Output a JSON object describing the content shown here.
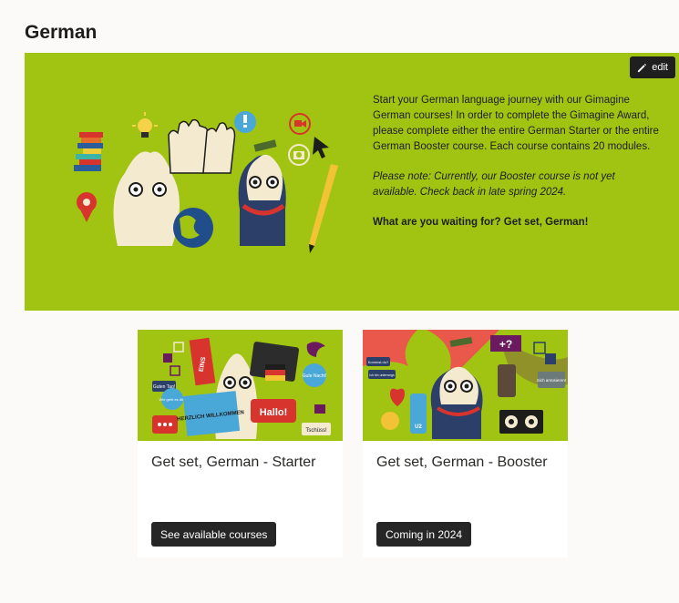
{
  "page": {
    "title": "German"
  },
  "hero": {
    "edit_label": "edit",
    "paragraph1": "Start your German language journey with our Gimagine German courses! In order to complete the Gimagine Award, please complete either the entire German Starter or the entire German Booster course. Each course contains 20 modules.",
    "note": "Please note: Currently, our Booster course is not yet available. Check back in late spring 2024.",
    "cta": "What are you waiting for? Get set, German!"
  },
  "cards": [
    {
      "title": "Get set, German - Starter",
      "button_label": "See available courses",
      "image_texts": {
        "eins": "EINS",
        "guten_tag": "Guten Tag!",
        "wie_gehts": "Wie geht es dir?",
        "herzlich": "HERZLICH WILLKOMMEN",
        "hallo": "Hallo!",
        "gute_nacht": "Gute Nacht!",
        "tschuess": "Tschüss!"
      }
    },
    {
      "title": "Get set, German - Booster",
      "button_label": "Coming in 2024",
      "image_texts": {
        "kommst": "Kommst du?",
        "bin_unterwegs": "Ich bin unterwegs",
        "sich_amuesieren": "Sich amüsieren!",
        "u2": "U2"
      }
    }
  ],
  "colors": {
    "hero_bg": "#a1c412",
    "button_bg": "#262626",
    "page_bg": "#fbfaf8"
  }
}
